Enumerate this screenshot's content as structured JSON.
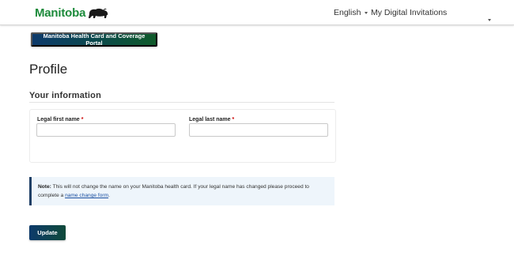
{
  "header": {
    "logo_text": "Manitoba",
    "language_label": "English",
    "invitations_label": "My Digital Invitations",
    "brand_color": "#1b8a3a"
  },
  "portal_button_label": "Manitoba Health Card and Coverage Portal",
  "page_title": "Profile",
  "section_title": "Your information",
  "form": {
    "first_name_label": "Legal first name",
    "last_name_label": "Legal last name",
    "required_marker": "*",
    "first_name_value": "",
    "last_name_value": ""
  },
  "note": {
    "prefix": "Note:",
    "text": " This will not change the name on your Manitoba health card. If your legal name has changed please proceed to complete a ",
    "link_text": "name change form",
    "suffix": "."
  },
  "update_button_label": "Update"
}
